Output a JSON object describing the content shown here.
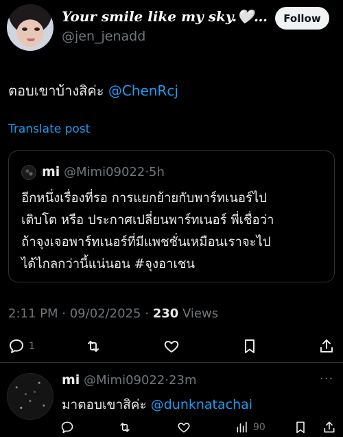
{
  "post": {
    "display_name": "Your smile like my sky.🤍…",
    "handle": "@jen_jenadd",
    "follow_label": "Follow",
    "text": "ตอบเขาบ้างสิค่ะ",
    "mention": "@ChenRcj",
    "translate_label": "Translate post",
    "time": "2:11 PM",
    "sep": "·",
    "date": "09/02/2025",
    "views_count": "230",
    "views_label": "Views",
    "reply_count": "1"
  },
  "quote": {
    "name": "mi",
    "handle_time": "@Mimi09022·5h",
    "lines": [
      "อีกหนึ่งเรื่องที่รอ การแยกย้ายกับพาร์ทเนอร์ไป",
      "เติบโต หรือ ประกาศเปลี่ยนพาร์ทเนอร์ พี่เชื่อว่า",
      "ถ้าจุงเจอพาร์ทเนอร์ที่มีแพชชั่นเหมือนเราจะไป",
      "ได้ไกลกว่านี้แน่นอน  #จุงอาเชน"
    ]
  },
  "reply": {
    "name": "mi",
    "handle_time": "@Mimi09022·23m",
    "more": "···",
    "text": "มาตอบเขาสิค่ะ",
    "mention": "@dunknatachai",
    "views_count": "90"
  },
  "colors": {
    "background": "#000000",
    "text": "#e7e9ea",
    "muted": "#71767b",
    "link": "#1d9bf0",
    "border": "#2f3336"
  },
  "icons": [
    "reply-icon",
    "retweet-icon",
    "like-icon",
    "bookmark-icon",
    "share-icon",
    "views-icon",
    "more-icon"
  ]
}
